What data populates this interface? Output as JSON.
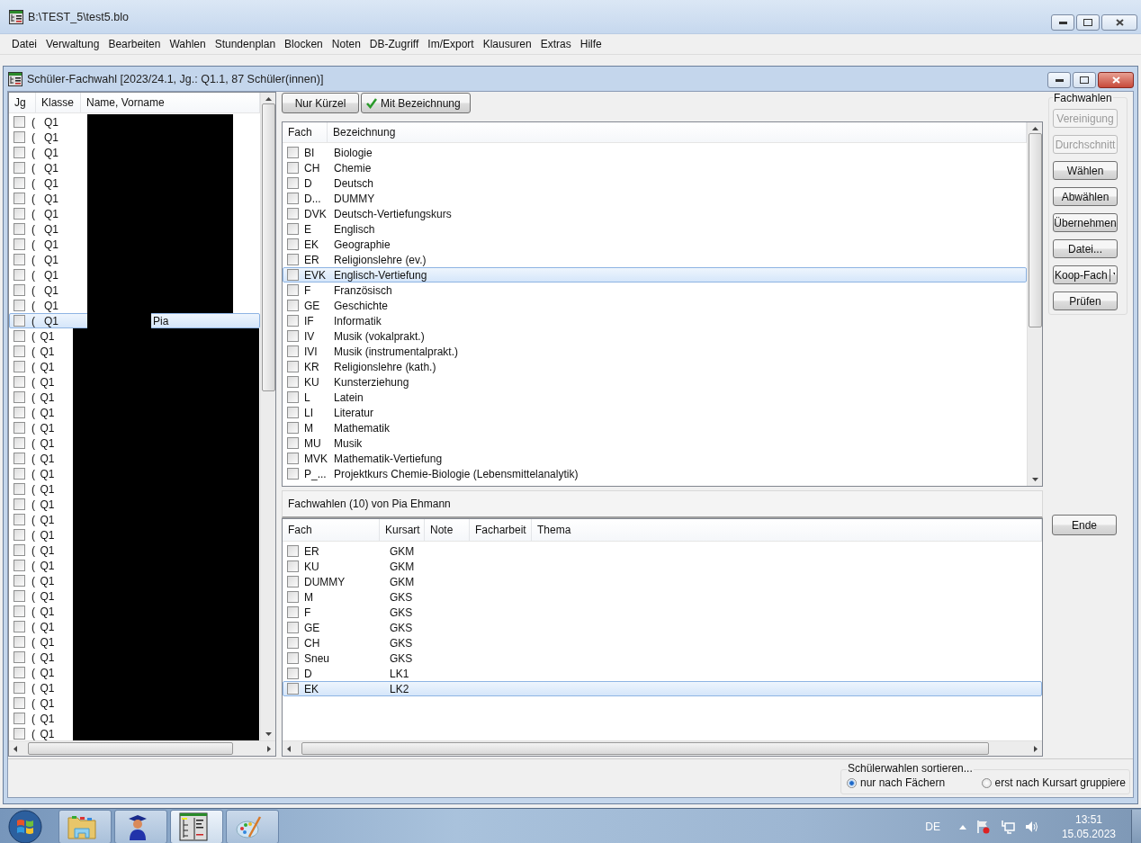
{
  "window": {
    "title": "B:\\TEST_5\\test5.blo"
  },
  "menu": [
    "Datei",
    "Verwaltung",
    "Bearbeiten",
    "Wahlen",
    "Stundenplan",
    "Blocken",
    "Noten",
    "DB-Zugriff",
    "Im/Export",
    "Klausuren",
    "Extras",
    "Hilfe"
  ],
  "child_window": {
    "title": "Schüler-Fachwahl [2023/24.1, Jg.: Q1.1, 87 Schüler(innen)]"
  },
  "students": {
    "columns": [
      "Jg",
      "Klasse",
      "Name, Vorname"
    ],
    "rows": [
      {
        "jg": "(",
        "klasse": "Q1",
        "checked": false,
        "selected": false
      },
      {
        "jg": "(",
        "klasse": "Q1",
        "checked": false,
        "selected": false
      },
      {
        "jg": "(",
        "klasse": "Q1",
        "checked": false,
        "selected": false
      },
      {
        "jg": "(",
        "klasse": "Q1",
        "checked": false,
        "selected": false
      },
      {
        "jg": "(",
        "klasse": "Q1",
        "checked": false,
        "selected": false
      },
      {
        "jg": "(",
        "klasse": "Q1",
        "checked": false,
        "selected": false
      },
      {
        "jg": "(",
        "klasse": "Q1",
        "checked": false,
        "selected": false
      },
      {
        "jg": "(",
        "klasse": "Q1",
        "checked": false,
        "selected": false
      },
      {
        "jg": "(",
        "klasse": "Q1",
        "checked": false,
        "selected": false
      },
      {
        "jg": "(",
        "klasse": "Q1",
        "checked": false,
        "selected": false
      },
      {
        "jg": "(",
        "klasse": "Q1",
        "checked": false,
        "selected": false
      },
      {
        "jg": "(",
        "klasse": "Q1",
        "checked": false,
        "selected": false
      },
      {
        "jg": "(",
        "klasse": "Q1",
        "checked": false,
        "selected": false
      },
      {
        "jg": "(",
        "klasse": "Q1",
        "name": "Pia",
        "checked": false,
        "selected": true
      },
      {
        "jg": "(",
        "klasse": "Q1",
        "checked": false,
        "selected": false
      },
      {
        "jg": "(",
        "klasse": "Q1",
        "checked": false,
        "selected": false
      },
      {
        "jg": "(",
        "klasse": "Q1",
        "checked": false,
        "selected": false
      },
      {
        "jg": "(",
        "klasse": "Q1",
        "checked": false,
        "selected": false
      },
      {
        "jg": "(",
        "klasse": "Q1",
        "checked": false,
        "selected": false
      },
      {
        "jg": "(",
        "klasse": "Q1",
        "checked": false,
        "selected": false
      },
      {
        "jg": "(",
        "klasse": "Q1",
        "checked": false,
        "selected": false
      },
      {
        "jg": "(",
        "klasse": "Q1",
        "checked": false,
        "selected": false
      },
      {
        "jg": "(",
        "klasse": "Q1",
        "checked": false,
        "selected": false
      },
      {
        "jg": "(",
        "klasse": "Q1",
        "checked": false,
        "selected": false
      },
      {
        "jg": "(",
        "klasse": "Q1",
        "checked": false,
        "selected": false
      },
      {
        "jg": "(",
        "klasse": "Q1",
        "checked": false,
        "selected": false
      },
      {
        "jg": "(",
        "klasse": "Q1",
        "checked": false,
        "selected": false
      },
      {
        "jg": "(",
        "klasse": "Q1",
        "checked": false,
        "selected": false
      },
      {
        "jg": "(",
        "klasse": "Q1",
        "checked": false,
        "selected": false
      },
      {
        "jg": "(",
        "klasse": "Q1",
        "checked": false,
        "selected": false
      },
      {
        "jg": "(",
        "klasse": "Q1",
        "checked": false,
        "selected": false
      },
      {
        "jg": "(",
        "klasse": "Q1",
        "checked": false,
        "selected": false
      },
      {
        "jg": "(",
        "klasse": "Q1",
        "checked": false,
        "selected": false
      },
      {
        "jg": "(",
        "klasse": "Q1",
        "checked": false,
        "selected": false
      },
      {
        "jg": "(",
        "klasse": "Q1",
        "checked": false,
        "selected": false
      },
      {
        "jg": "(",
        "klasse": "Q1",
        "checked": false,
        "selected": false
      },
      {
        "jg": "(",
        "klasse": "Q1",
        "checked": false,
        "selected": false
      },
      {
        "jg": "(",
        "klasse": "Q1",
        "checked": false,
        "selected": false
      },
      {
        "jg": "(",
        "klasse": "Q1",
        "checked": false,
        "selected": false
      },
      {
        "jg": "(",
        "klasse": "Q1",
        "checked": false,
        "selected": false
      },
      {
        "jg": "(",
        "klasse": "Q1",
        "checked": false,
        "selected": false
      }
    ]
  },
  "view_buttons": [
    {
      "label": "Nur Kürzel",
      "checked": false
    },
    {
      "label": "Mit Bezeichnung",
      "checked": true
    }
  ],
  "subjects": {
    "columns": [
      "Fach",
      "Bezeichnung"
    ],
    "rows": [
      {
        "fach": "BI",
        "bezeichnung": "Biologie",
        "checked": false,
        "selected": false
      },
      {
        "fach": "CH",
        "bezeichnung": "Chemie",
        "checked": false,
        "selected": false
      },
      {
        "fach": "D",
        "bezeichnung": "Deutsch",
        "checked": false,
        "selected": false
      },
      {
        "fach": "D...",
        "bezeichnung": "DUMMY",
        "checked": false,
        "selected": false
      },
      {
        "fach": "DVK",
        "bezeichnung": "Deutsch-Vertiefungskurs",
        "checked": false,
        "selected": false
      },
      {
        "fach": "E",
        "bezeichnung": "Englisch",
        "checked": false,
        "selected": false
      },
      {
        "fach": "EK",
        "bezeichnung": "Geographie",
        "checked": false,
        "selected": false
      },
      {
        "fach": "ER",
        "bezeichnung": "Religionslehre (ev.)",
        "checked": false,
        "selected": false
      },
      {
        "fach": "EVK",
        "bezeichnung": "Englisch-Vertiefung",
        "checked": false,
        "selected": true
      },
      {
        "fach": "F",
        "bezeichnung": "Französisch",
        "checked": false,
        "selected": false
      },
      {
        "fach": "GE",
        "bezeichnung": "Geschichte",
        "checked": false,
        "selected": false
      },
      {
        "fach": "IF",
        "bezeichnung": "Informatik",
        "checked": false,
        "selected": false
      },
      {
        "fach": "IV",
        "bezeichnung": "Musik (vokalprakt.)",
        "checked": false,
        "selected": false
      },
      {
        "fach": "IVI",
        "bezeichnung": "Musik (instrumentalprakt.)",
        "checked": false,
        "selected": false
      },
      {
        "fach": "KR",
        "bezeichnung": "Religionslehre (kath.)",
        "checked": false,
        "selected": false
      },
      {
        "fach": "KU",
        "bezeichnung": "Kunsterziehung",
        "checked": false,
        "selected": false
      },
      {
        "fach": "L",
        "bezeichnung": "Latein",
        "checked": false,
        "selected": false
      },
      {
        "fach": "LI",
        "bezeichnung": "Literatur",
        "checked": false,
        "selected": false
      },
      {
        "fach": "M",
        "bezeichnung": "Mathematik",
        "checked": false,
        "selected": false
      },
      {
        "fach": "MU",
        "bezeichnung": "Musik",
        "checked": false,
        "selected": false
      },
      {
        "fach": "MVK",
        "bezeichnung": "Mathematik-Vertiefung",
        "checked": false,
        "selected": false
      },
      {
        "fach": "P_...",
        "bezeichnung": "Projektkurs Chemie-Biologie (Lebensmittelanalytik)",
        "checked": false,
        "selected": false
      }
    ]
  },
  "choices": {
    "title": "Fachwahlen (10) von Pia Ehmann",
    "columns": [
      "Fach",
      "Kursart",
      "Note",
      "Facharbeit",
      "Thema"
    ],
    "rows": [
      {
        "fach": "ER",
        "kursart": "GKM",
        "checked": false,
        "selected": false
      },
      {
        "fach": "KU",
        "kursart": "GKM",
        "checked": false,
        "selected": false
      },
      {
        "fach": "DUMMY",
        "kursart": "GKM",
        "checked": false,
        "selected": false
      },
      {
        "fach": "M",
        "kursart": "GKS",
        "checked": false,
        "selected": false
      },
      {
        "fach": "F",
        "kursart": "GKS",
        "checked": false,
        "selected": false
      },
      {
        "fach": "GE",
        "kursart": "GKS",
        "checked": false,
        "selected": false
      },
      {
        "fach": "CH",
        "kursart": "GKS",
        "checked": false,
        "selected": false
      },
      {
        "fach": "Sneu",
        "kursart": "GKS",
        "checked": false,
        "selected": false
      },
      {
        "fach": "D",
        "kursart": "LK1",
        "checked": false,
        "selected": false
      },
      {
        "fach": "EK",
        "kursart": "LK2",
        "checked": false,
        "selected": true
      }
    ]
  },
  "actions": {
    "title": "Fachwahlen",
    "buttons": [
      {
        "label": "Vereinigung",
        "kind": "button",
        "disabled": true
      },
      {
        "label": "Durchschnitt",
        "kind": "button",
        "disabled": true
      },
      {
        "label": "Wählen",
        "kind": "button",
        "disabled": false
      },
      {
        "label": "Abwählen",
        "kind": "button",
        "disabled": false
      },
      {
        "label": "Übernehmen",
        "kind": "button",
        "disabled": false
      },
      {
        "label": "Datei...",
        "kind": "button",
        "disabled": false
      },
      {
        "label": "Koop-Fach",
        "kind": "dropdown",
        "disabled": false
      },
      {
        "label": "Prüfen",
        "kind": "button",
        "disabled": false
      }
    ],
    "end_button": "Ende"
  },
  "sort": {
    "title": "Schülerwahlen sortieren...",
    "options": [
      {
        "label": "nur nach Fächern",
        "selected": true
      },
      {
        "label": "erst nach Kursart gruppiere",
        "selected": false
      }
    ]
  },
  "taskbar": {
    "apps": [
      {
        "kind": "folder",
        "selected": false
      },
      {
        "kind": "graduate",
        "selected": false
      },
      {
        "kind": "tree",
        "selected": true
      },
      {
        "kind": "palette",
        "selected": false
      }
    ],
    "language": "DE",
    "time": "13:51",
    "date": "15.05.2023"
  }
}
